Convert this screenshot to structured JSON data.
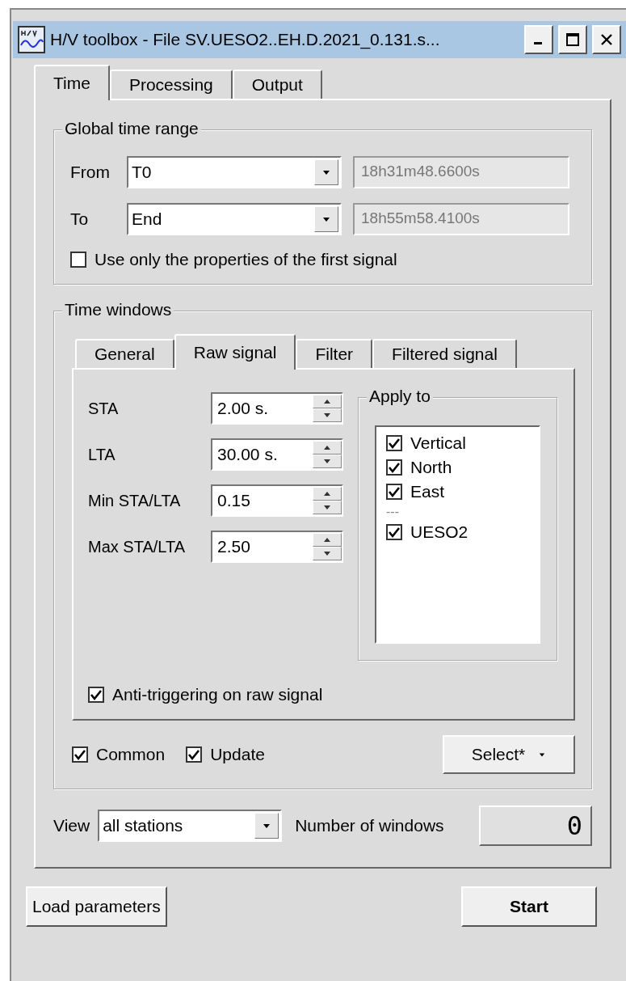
{
  "window": {
    "title": "H/V toolbox - File SV.UESO2..EH.D.2021_0.131.s..."
  },
  "tabs": [
    {
      "label": "Time",
      "selected": true
    },
    {
      "label": "Processing",
      "selected": false
    },
    {
      "label": "Output",
      "selected": false
    }
  ],
  "global_time_range": {
    "title": "Global time range",
    "rows": [
      {
        "label": "From",
        "value": "T0",
        "time": "18h31m48.6600s",
        "disabled": true
      },
      {
        "label": "To",
        "value": "End",
        "time": "18h55m58.4100s",
        "disabled": true
      }
    ],
    "first_signal": {
      "label": "Use only the properties of the first signal",
      "checked": false
    }
  },
  "time_windows": {
    "title": "Time windows",
    "tabs": [
      {
        "label": "General",
        "selected": false
      },
      {
        "label": "Raw signal",
        "selected": true
      },
      {
        "label": "Filter",
        "selected": false
      },
      {
        "label": "Filtered signal",
        "selected": false
      }
    ],
    "params": [
      {
        "label": "STA",
        "value": "2.00 s."
      },
      {
        "label": "LTA",
        "value": "30.00 s."
      },
      {
        "label": "Min STA/LTA",
        "value": "0.15"
      },
      {
        "label": "Max STA/LTA",
        "value": "2.50"
      }
    ],
    "apply_to": {
      "title": "Apply to",
      "items": [
        {
          "kind": "check",
          "label": "Vertical",
          "checked": true
        },
        {
          "kind": "check",
          "label": "North",
          "checked": true
        },
        {
          "kind": "check",
          "label": "East",
          "checked": true
        },
        {
          "kind": "separator",
          "label": "---"
        },
        {
          "kind": "check",
          "label": "UESO2",
          "checked": true
        }
      ]
    },
    "anti_triggering": {
      "label": "Anti-triggering on raw signal",
      "checked": true
    },
    "common": {
      "label": "Common",
      "checked": true
    },
    "update": {
      "label": "Update",
      "checked": true
    },
    "select_button": "Select*"
  },
  "view": {
    "label": "View",
    "value": "all stations"
  },
  "number_of_windows": {
    "label": "Number of windows",
    "value": "0"
  },
  "buttons": {
    "load": "Load parameters",
    "start": "Start"
  }
}
